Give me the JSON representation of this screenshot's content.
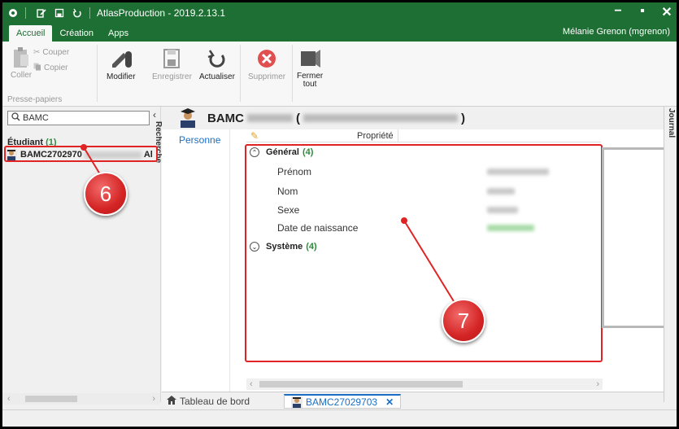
{
  "titlebar": {
    "title": "AtlasProduction - 2019.2.13.1",
    "controls": [
      "minimize-icon",
      "maximize-icon",
      "close-icon"
    ]
  },
  "ribbon_tabs": [
    {
      "label": "Accueil",
      "active": true
    },
    {
      "label": "Création",
      "active": false
    },
    {
      "label": "Apps",
      "active": false
    }
  ],
  "user": {
    "name": "Mélanie Grenon (mgrenon)"
  },
  "ribbon": {
    "coller": "Coller",
    "couper": "Couper",
    "copier": "Copier",
    "group_label": "Presse-papiers",
    "modifier": "Modifier",
    "enregistrer": "Enregistrer",
    "actualiser": "Actualiser",
    "supprimer": "Supprimer",
    "fermer_line1": "Fermer",
    "fermer_line2": "tout"
  },
  "left": {
    "search_value": "BAMC",
    "vtab": "Recherche",
    "group_title": "Étudiant",
    "group_count": "(1)",
    "student_id_prefix": "BAMC2702970",
    "student_suffix": "Al"
  },
  "main": {
    "title_prefix": "BAMC",
    "title_open": "(",
    "title_close": ")",
    "right_vtab": "Journal",
    "nav": {
      "personne": "Personne"
    },
    "column_header": "Propriété",
    "groups": [
      {
        "label": "Général",
        "count": "(4)",
        "expanded": true,
        "rows": [
          "Prénom",
          "Nom",
          "Sexe",
          "Date de naissance"
        ]
      },
      {
        "label": "Système",
        "count": "(4)",
        "expanded": false
      }
    ]
  },
  "bottom_tabs": {
    "dashboard": "Tableau de bord",
    "record": "BAMC27029703"
  },
  "callouts": {
    "c6": "6",
    "c7": "7"
  },
  "colors": {
    "titlebar": "#1e6f34",
    "accent": "#1a6fc4",
    "highlight": "#e02424",
    "count_green": "#2e8b3c"
  }
}
